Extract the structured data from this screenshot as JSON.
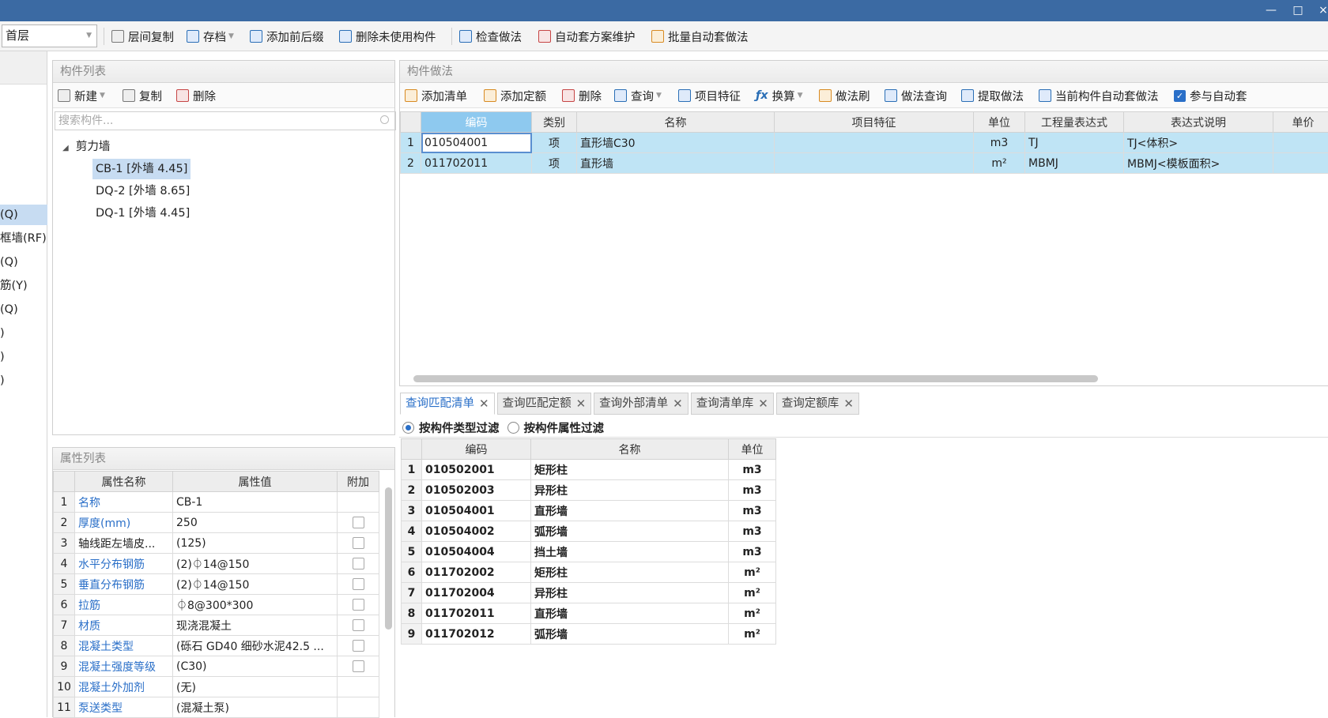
{
  "toolbar": {
    "floor": "首层",
    "items": [
      "层间复制",
      "存档",
      "添加前后缀",
      "删除未使用构件",
      "检查做法",
      "自动套方案维护",
      "批量自动套做法"
    ]
  },
  "left_strip": [
    "(Q)",
    "框墙(RF)",
    "(Q)",
    "筋(Y)",
    "(Q)",
    ")",
    ")",
    ")"
  ],
  "component_list": {
    "title": "构件列表",
    "tools": [
      "新建",
      "复制",
      "删除"
    ],
    "search_placeholder": "搜索构件...",
    "tree_group": "剪力墙",
    "items": [
      "CB-1 [外墙 4.45]",
      "DQ-2 [外墙 8.65]",
      "DQ-1 [外墙 4.45]"
    ]
  },
  "properties": {
    "title": "属性列表",
    "headers": [
      "属性名称",
      "属性值",
      "附加"
    ],
    "rows": [
      {
        "n": "1",
        "name": "名称",
        "value": "CB-1"
      },
      {
        "n": "2",
        "name": "厚度(mm)",
        "value": "250"
      },
      {
        "n": "3",
        "name": "轴线距左墙皮...",
        "value": "(125)"
      },
      {
        "n": "4",
        "name": "水平分布钢筋",
        "value": "(2)⏀14@150"
      },
      {
        "n": "5",
        "name": "垂直分布钢筋",
        "value": "(2)⏀14@150"
      },
      {
        "n": "6",
        "name": "拉筋",
        "value": "⏀8@300*300"
      },
      {
        "n": "7",
        "name": "材质",
        "value": "现浇混凝土"
      },
      {
        "n": "8",
        "name": "混凝土类型",
        "value": "(砾石 GD40 细砂水泥42.5 ..."
      },
      {
        "n": "9",
        "name": "混凝土强度等级",
        "value": "(C30)"
      },
      {
        "n": "10",
        "name": "混凝土外加剂",
        "value": "(无)"
      },
      {
        "n": "11",
        "name": "泵送类型",
        "value": "(混凝土泵)"
      }
    ]
  },
  "method": {
    "title": "构件做法",
    "tools": [
      "添加清单",
      "添加定额",
      "删除",
      "查询",
      "项目特征",
      "换算",
      "做法刷",
      "做法查询",
      "提取做法",
      "当前构件自动套做法",
      "参与自动套"
    ],
    "headers": [
      "编码",
      "类别",
      "名称",
      "项目特征",
      "单位",
      "工程量表达式",
      "表达式说明",
      "单价"
    ],
    "rows": [
      {
        "n": "1",
        "code": "010504001",
        "type": "项",
        "name": "直形墙C30",
        "feature": "",
        "unit": "m3",
        "expr": "TJ",
        "desc": "TJ<体积>"
      },
      {
        "n": "2",
        "code": "011702011",
        "type": "项",
        "name": "直形墙",
        "feature": "",
        "unit": "m²",
        "expr": "MBMJ",
        "desc": "MBMJ<模板面积>"
      }
    ]
  },
  "query": {
    "tabs": [
      "查询匹配清单",
      "查询匹配定额",
      "查询外部清单",
      "查询清单库",
      "查询定额库"
    ],
    "filters": [
      "按构件类型过滤",
      "按构件属性过滤"
    ],
    "headers": [
      "编码",
      "名称",
      "单位"
    ],
    "rows": [
      {
        "n": "1",
        "code": "010502001",
        "name": "矩形柱",
        "unit": "m3"
      },
      {
        "n": "2",
        "code": "010502003",
        "name": "异形柱",
        "unit": "m3"
      },
      {
        "n": "3",
        "code": "010504001",
        "name": "直形墙",
        "unit": "m3"
      },
      {
        "n": "4",
        "code": "010504002",
        "name": "弧形墙",
        "unit": "m3"
      },
      {
        "n": "5",
        "code": "010504004",
        "name": "挡土墙",
        "unit": "m3"
      },
      {
        "n": "6",
        "code": "011702002",
        "name": "矩形柱",
        "unit": "m²"
      },
      {
        "n": "7",
        "code": "011702004",
        "name": "异形柱",
        "unit": "m²"
      },
      {
        "n": "8",
        "code": "011702011",
        "name": "直形墙",
        "unit": "m²"
      },
      {
        "n": "9",
        "code": "011702012",
        "name": "弧形墙",
        "unit": "m²"
      }
    ]
  },
  "window": {
    "minimize": "—",
    "maximize": "□",
    "close": "×"
  }
}
